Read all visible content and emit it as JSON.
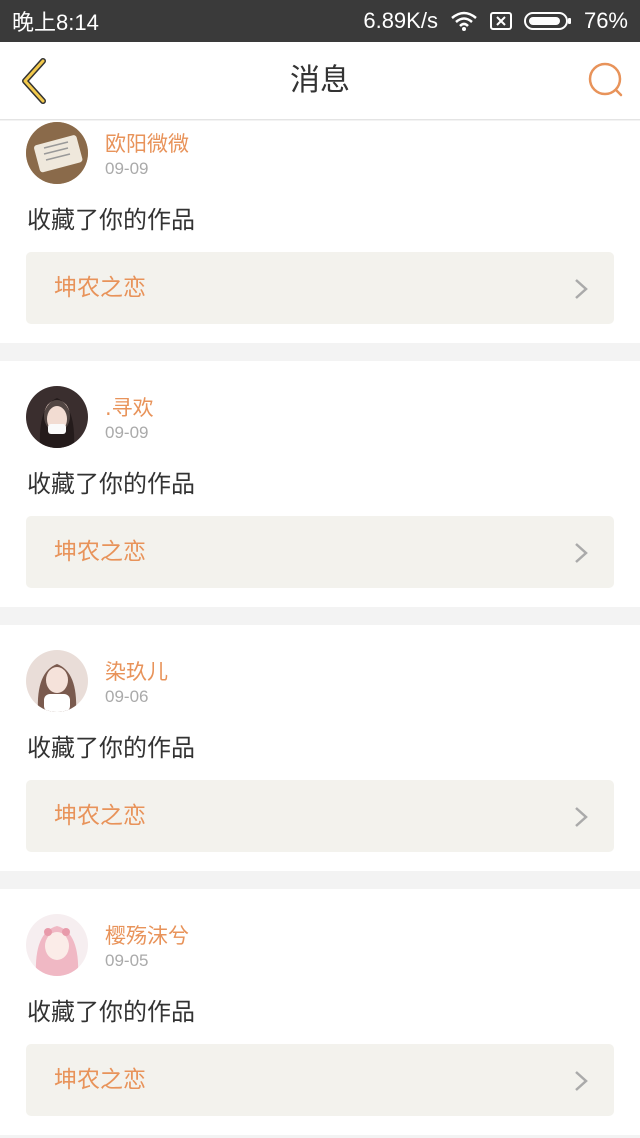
{
  "status_bar": {
    "time": "晚上8:14",
    "speed": "6.89K/s",
    "battery": "76%",
    "icons": [
      "wifi-icon",
      "sim-icon",
      "battery-icon"
    ]
  },
  "header": {
    "title": "消息",
    "back_icon": "chevron-left-icon",
    "search_icon": "search-icon"
  },
  "colors": {
    "accent": "#e8935a",
    "back": "#f2c94c",
    "card_bg": "#f3f2ed"
  },
  "messages": [
    {
      "user": "欧阳微微",
      "date": "09-09",
      "action": "收藏了你的作品",
      "work": "坤农之恋"
    },
    {
      "user": ".寻欢",
      "date": "09-09",
      "action": "收藏了你的作品",
      "work": "坤农之恋"
    },
    {
      "user": "染玖儿",
      "date": "09-06",
      "action": "收藏了你的作品",
      "work": "坤农之恋"
    },
    {
      "user": "樱殇沫兮",
      "date": "09-05",
      "action": "收藏了你的作品",
      "work": "坤农之恋"
    }
  ]
}
